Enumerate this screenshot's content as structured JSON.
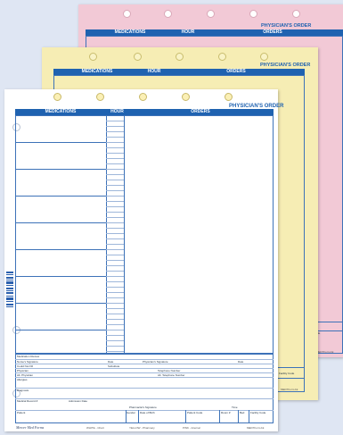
{
  "form": {
    "title": "PHYSICIAN'S ORDER",
    "col_medications": "MEDICATIONS",
    "col_hour": "HOUR",
    "col_orders": "ORDERS"
  },
  "footer_fields": {
    "medication_review": "Medication Review",
    "nurse_signature": "Nurse's Signature",
    "date": "Date",
    "physician_signature": "Physician's Signature",
    "date2": "Date",
    "could_not_fill": "Could Not Fill",
    "substitute": "Substitute",
    "physician": "Physician",
    "telephone_number": "Telephone Number",
    "alt_physician": "Alt. Physician",
    "alt_telephone_number": "Alt. Telephone Number",
    "allergies": "Allergies",
    "diagnosis": "Diagnosis",
    "medical_record": "Medical Record #",
    "admission_date": "Admission Date",
    "pharmacist_signature": "Pharmacist's Signature",
    "time": "Time",
    "patient": "Patient",
    "gender": "Gender",
    "date_of_birth": "Date of Birth",
    "patient_code": "Patient Code",
    "room": "Room #",
    "bed": "Bed",
    "facility_code": "Facility Code"
  },
  "copy_labels": {
    "brand": "Mercer Med Forms",
    "white": "WHITE - Chart",
    "yellow": "YELLOW - Pharmacy",
    "pink": "PINK - Internal",
    "form_number": "MED7Form.bk"
  },
  "colors": {
    "white_copy": "#ffffff",
    "yellow_copy": "#f6edb4",
    "pink_copy": "#f2c9d6",
    "accent": "#1f62b0"
  }
}
